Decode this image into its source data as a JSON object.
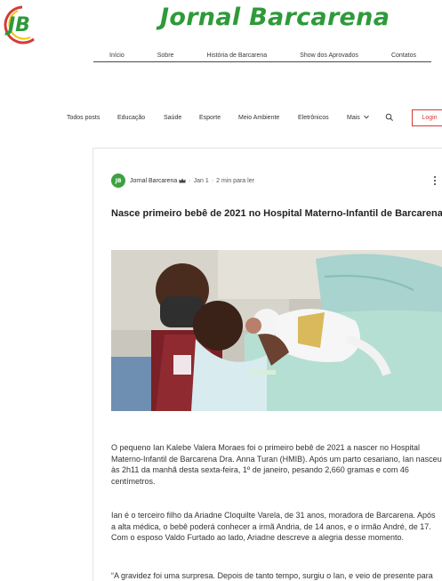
{
  "brand": {
    "logo_text": "JB",
    "site_title": "Jornal Barcarena",
    "colors": {
      "green": "#2e9a3a",
      "red": "#d43a3a",
      "accent_yellow": "#f2c100"
    }
  },
  "topnav": {
    "items": [
      {
        "label": "Início"
      },
      {
        "label": "Sobre"
      },
      {
        "label": "História de Barcarena"
      },
      {
        "label": "Show dos Aprovados"
      },
      {
        "label": "Contatos"
      }
    ]
  },
  "blog_menu": {
    "categories": [
      {
        "label": "Todos posts"
      },
      {
        "label": "Educação"
      },
      {
        "label": "Saúde"
      },
      {
        "label": "Esporte"
      },
      {
        "label": "Meio Ambiente"
      },
      {
        "label": "Eletrônicos"
      }
    ],
    "more_label": "Mais",
    "more_icon": "chevron-down-icon",
    "search_icon": "search-icon",
    "login_label": "Login"
  },
  "post": {
    "author": "Jornal Barcarena",
    "author_badge_icon": "crown-icon",
    "date": "Jan 1",
    "separator": "·",
    "read_time": "2 min para ler",
    "title": "Nasce primeiro bebê de 2021 no Hospital Materno-Infantil de Barcarena",
    "image_alt": "photo-father-mother-newborn-hospital",
    "paragraphs": [
      "O pequeno Ian Kalebe Valera Moraes foi o primeiro bebê de 2021 a nascer no Hospital Materno-Infantil de Barcarena Dra. Anna Turan (HMIB). Após um parto cesariano, Ian nasceu às 2h11 da manhã desta sexta-feira, 1º de janeiro, pesando 2,660 gramas e com 46 centímetros.",
      "Ian é o terceiro filho da Ariadne Cloquilte Varela, de 31 anos, moradora de Barcarena. Após a alta médica, o bebê poderá conhecer a irmã Andria, de 14 anos, e o irmão André, de 17. Com o esposo Valdo Furtado ao lado, Ariadne descreve a alegria desse momento.",
      "“A gravidez foi uma surpresa. Depois de tanto tempo, surgiu o Ian, e veio de presente para"
    ]
  }
}
